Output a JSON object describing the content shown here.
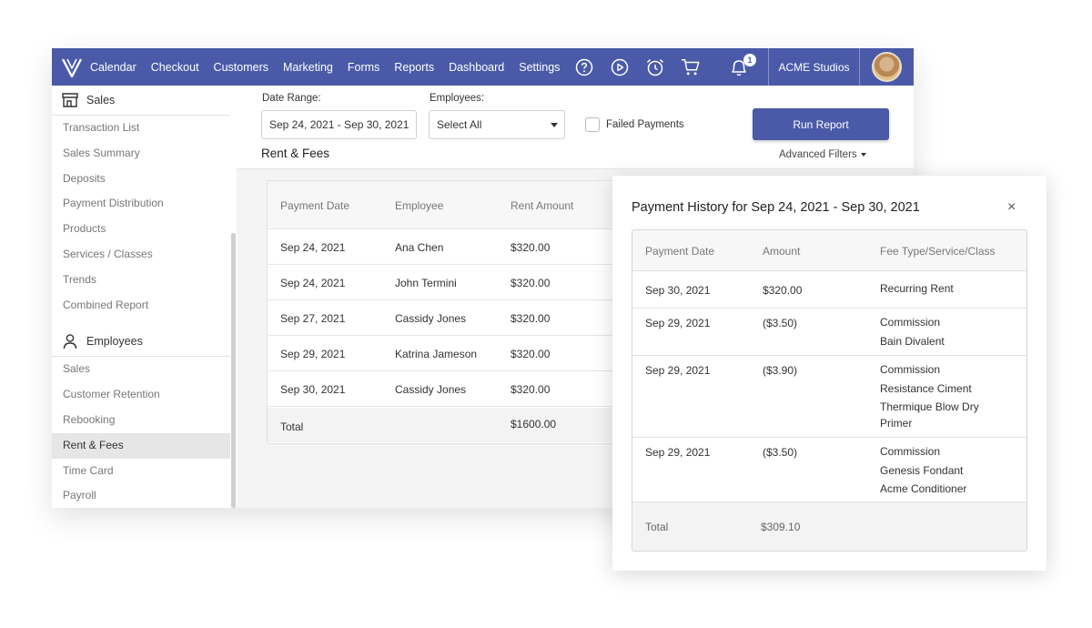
{
  "nav": {
    "items": [
      "Calendar",
      "Checkout",
      "Customers",
      "Marketing",
      "Forms",
      "Reports",
      "Dashboard",
      "Settings"
    ],
    "notification_count": "1",
    "studio": "ACME Studios",
    "brand_color": "#4a5aa8"
  },
  "sidebar": {
    "sales_header": "Sales",
    "sales_items": [
      "Transaction List",
      "Sales Summary",
      "Deposits",
      "Payment Distribution",
      "Products",
      "Services / Classes",
      "Trends",
      "Combined Report"
    ],
    "employees_header": "Employees",
    "employees_items": [
      "Sales",
      "Customer Retention",
      "Rebooking",
      "Rent & Fees",
      "Time Card",
      "Payroll"
    ],
    "active_item": "Rent & Fees"
  },
  "filters": {
    "date_range_label": "Date Range:",
    "date_range_value": "Sep 24, 2021 - Sep 30, 2021",
    "employees_label": "Employees:",
    "employees_value": "Select All",
    "failed_payments_label": "Failed Payments",
    "run_report": "Run Report",
    "advanced_filters": "Advanced Filters"
  },
  "report": {
    "title": "Rent & Fees",
    "columns": [
      "Payment Date",
      "Employee",
      "Rent Amount"
    ],
    "rows": [
      [
        "Sep 24, 2021",
        "Ana Chen",
        "$320.00"
      ],
      [
        "Sep 24, 2021",
        "John Termini",
        "$320.00"
      ],
      [
        "Sep 27, 2021",
        "Cassidy Jones",
        "$320.00"
      ],
      [
        "Sep 29, 2021",
        "Katrina Jameson",
        "$320.00"
      ],
      [
        "Sep 30, 2021",
        "Cassidy Jones",
        "$320.00"
      ]
    ],
    "total_label": "Total",
    "total_value": "$1600.00"
  },
  "modal": {
    "title": "Payment History for Sep 24, 2021 - Sep 30, 2021",
    "close": "×",
    "columns": [
      "Payment Date",
      "Amount",
      "Fee Type/Service/Class"
    ],
    "rows": [
      {
        "date": "Sep 30, 2021",
        "amount": "$320.00",
        "lines": [
          "Recurring Rent"
        ]
      },
      {
        "date": "Sep 29, 2021",
        "amount": "($3.50)",
        "lines": [
          "Commission",
          "Bain Divalent"
        ]
      },
      {
        "date": "Sep 29, 2021",
        "amount": "($3.90)",
        "lines": [
          "Commission",
          "Resistance Ciment",
          "Thermique Blow Dry",
          "Primer"
        ]
      },
      {
        "date": "Sep 29, 2021",
        "amount": "($3.50)",
        "lines": [
          "Commission",
          "Genesis Fondant",
          "Acme Conditioner"
        ]
      }
    ],
    "total_label": "Total",
    "total_value": "$309.10"
  }
}
